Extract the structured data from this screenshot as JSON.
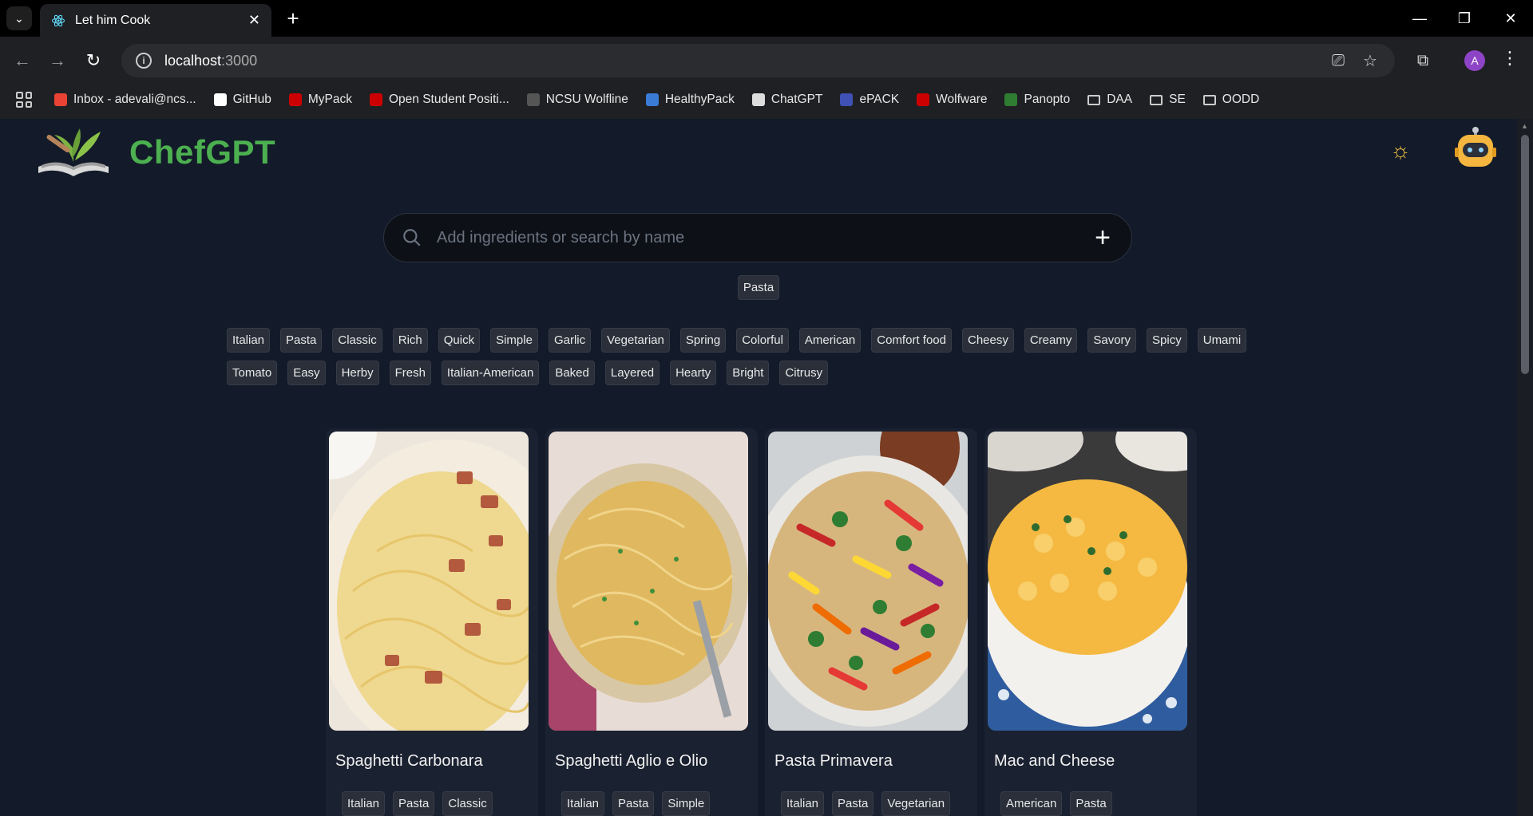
{
  "browser": {
    "tab_title": "Let him Cook",
    "url_host": "localhost",
    "url_port": ":3000",
    "profile_initial": "A",
    "bookmarks": [
      {
        "label": "Inbox - adevali@ncs...",
        "icon": "gmail-icon",
        "color": "#ea4335"
      },
      {
        "label": "GitHub",
        "icon": "github-icon",
        "color": "#ffffff"
      },
      {
        "label": "MyPack",
        "icon": "mypack-icon",
        "color": "#cc0000"
      },
      {
        "label": "Open Student Positi...",
        "icon": "ncsu-icon",
        "color": "#cc0000"
      },
      {
        "label": "NCSU Wolfline",
        "icon": "wolfline-icon",
        "color": "#555555"
      },
      {
        "label": "HealthyPack",
        "icon": "healthypack-icon",
        "color": "#3a7bd5"
      },
      {
        "label": "ChatGPT",
        "icon": "chatgpt-icon",
        "color": "#dddddd"
      },
      {
        "label": "ePACK",
        "icon": "epack-icon",
        "color": "#3f51b5"
      },
      {
        "label": "Wolfware",
        "icon": "wolfware-icon",
        "color": "#cc0000"
      },
      {
        "label": "Panopto",
        "icon": "panopto-icon",
        "color": "#2e7d32"
      },
      {
        "label": "DAA",
        "icon": "folder-icon",
        "color": "#cccccc"
      },
      {
        "label": "SE",
        "icon": "folder-icon",
        "color": "#cccccc"
      },
      {
        "label": "OODD",
        "icon": "folder-icon",
        "color": "#cccccc"
      }
    ]
  },
  "app": {
    "brand": "ChefGPT",
    "search_placeholder": "Add ingredients or search by name",
    "selected_ingredients": [
      "Pasta"
    ],
    "tags": [
      "Italian",
      "Pasta",
      "Classic",
      "Rich",
      "Quick",
      "Simple",
      "Garlic",
      "Vegetarian",
      "Spring",
      "Colorful",
      "American",
      "Comfort food",
      "Cheesy",
      "Creamy",
      "Savory",
      "Spicy",
      "Umami",
      "Tomato",
      "Easy",
      "Herby",
      "Fresh",
      "Italian-American",
      "Baked",
      "Layered",
      "Hearty",
      "Bright",
      "Citrusy"
    ],
    "recipes": [
      {
        "name": "Spaghetti Carbonara",
        "tags": [
          "Italian",
          "Pasta",
          "Classic"
        ]
      },
      {
        "name": "Spaghetti Aglio e Olio",
        "tags": [
          "Italian",
          "Pasta",
          "Simple"
        ]
      },
      {
        "name": "Pasta Primavera",
        "tags": [
          "Italian",
          "Pasta",
          "Vegetarian"
        ]
      },
      {
        "name": "Mac and Cheese",
        "tags": [
          "American",
          "Pasta"
        ]
      }
    ]
  }
}
